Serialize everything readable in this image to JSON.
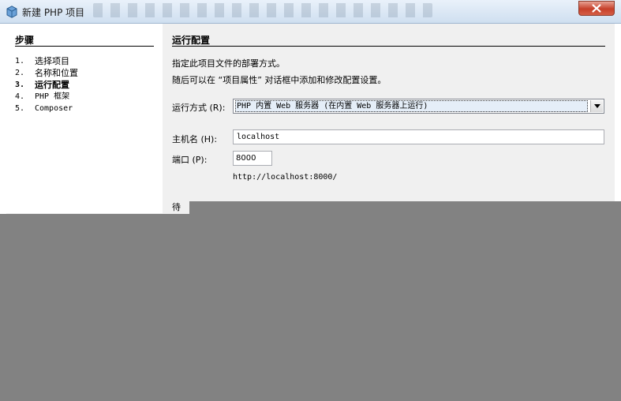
{
  "window": {
    "title": "新建 PHP 项目"
  },
  "steps": {
    "title": "步骤",
    "items": [
      {
        "num": "1.",
        "label": "选择项目"
      },
      {
        "num": "2.",
        "label": "名称和位置"
      },
      {
        "num": "3.",
        "label": "运行配置"
      },
      {
        "num": "4.",
        "label": "PHP 框架"
      },
      {
        "num": "5.",
        "label": "Composer"
      }
    ]
  },
  "config": {
    "title": "运行配置",
    "desc1": "指定此项目文件的部署方式。",
    "desc2": "随后可以在 “项目属性” 对话框中添加和修改配置设置。",
    "run_label": "运行方式 (R):",
    "run_value": "PHP 内置 Web 服务器 (在内置 Web 服务器上运行)",
    "host_label": "主机名 (H):",
    "host_value": "localhost",
    "port_label": "端口 (P):",
    "port_value": "8000",
    "url": "http://localhost:8000/",
    "partial": "待"
  },
  "colors": {
    "overlay": "#828282",
    "close_button": "#c6402a",
    "dialog_bg": "#f0f0f0"
  }
}
